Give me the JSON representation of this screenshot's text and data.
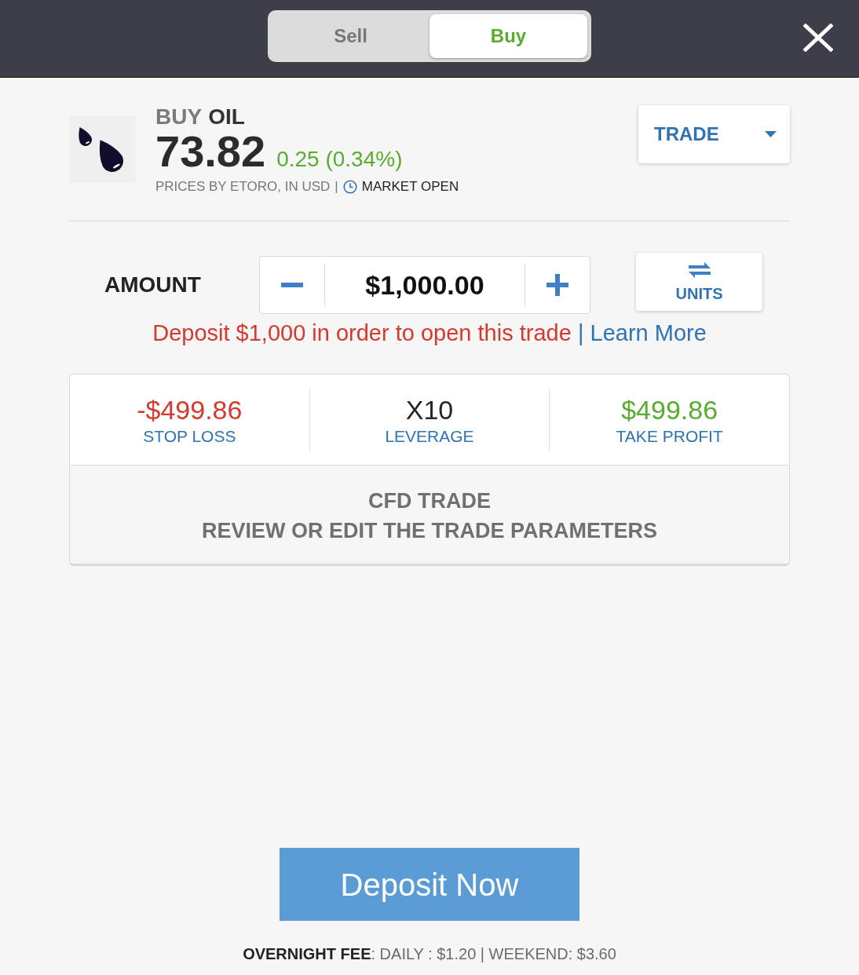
{
  "header": {
    "tabs": [
      {
        "label": "Sell",
        "selected": false
      },
      {
        "label": "Buy",
        "selected": true
      }
    ]
  },
  "instrument": {
    "action": "BUY",
    "name": "OIL",
    "price": "73.82",
    "change": "0.25 (0.34%)",
    "source": "PRICES BY ETORO, IN USD",
    "separator": "|",
    "market_status": "MARKET OPEN"
  },
  "order_type": {
    "label": "TRADE"
  },
  "amount": {
    "label": "AMOUNT",
    "value": "$1,000.00",
    "toggle_label": "UNITS"
  },
  "notice": {
    "text": "Deposit $1,000 in order to open this trade",
    "separator": "|",
    "link": "Learn More"
  },
  "parameters": [
    {
      "value": "-$499.86",
      "label": "STOP LOSS",
      "color": "#d63a2e"
    },
    {
      "value": "X10",
      "label": "LEVERAGE",
      "color": "#262626"
    },
    {
      "value": "$499.86",
      "label": "TAKE PROFIT",
      "color": "#5aac2f"
    }
  ],
  "summary": {
    "title": "CFD TRADE",
    "subtitle": "REVIEW OR EDIT THE TRADE PARAMETERS"
  },
  "deposit_button": "Deposit Now",
  "overnight_fee": "**OVERNIGHT FEE**: DAILY : $1.20 | WEEKEND: $3.60"
}
